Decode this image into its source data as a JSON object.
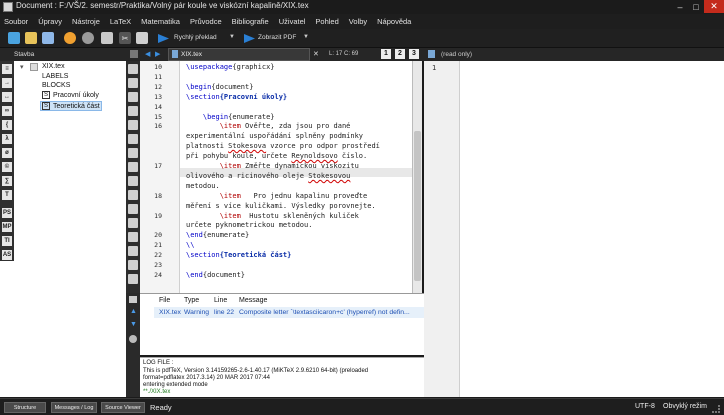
{
  "window": {
    "title": "Document : F:/VŠ/2. semestr/Praktika/Volný pár koule ve viskózní kapalině/XIX.tex"
  },
  "menu": [
    "Soubor",
    "Úpravy",
    "Nástroje",
    "LaTeX",
    "Matematika",
    "Průvodce",
    "Bibliografie",
    "Uživatel",
    "Pohled",
    "Volby",
    "Nápověda"
  ],
  "toolbar": {
    "quick_build": "Rychlý překlad",
    "view_pdf": "Zobrazit PDF"
  },
  "tabbar": {
    "structure_label": "Stavba",
    "file_tab": "XIX.tex",
    "cursor": "L: 17 C: 69",
    "readonly": "(read only)",
    "view_nums": [
      "1",
      "2",
      "3"
    ]
  },
  "structure": {
    "root": "XIX.tex",
    "labels": "LABELS",
    "blocks": "BLOCKS",
    "sections": [
      "Pracovní úkoly",
      "Teoretická část"
    ]
  },
  "editor": {
    "lines": [
      {
        "n": "10",
        "segments": [
          {
            "t": "\\usepackage",
            "c": "kw"
          },
          {
            "t": "{graphicx}",
            "c": ""
          }
        ]
      },
      {
        "n": "11",
        "segments": []
      },
      {
        "n": "12",
        "segments": [
          {
            "t": "\\begin",
            "c": "kw"
          },
          {
            "t": "{document}",
            "c": ""
          }
        ]
      },
      {
        "n": "13",
        "segments": [
          {
            "t": "\\section",
            "c": "kw"
          },
          {
            "t": "{Pracovní úkoly}",
            "c": "sec"
          }
        ]
      },
      {
        "n": "14",
        "segments": []
      },
      {
        "n": "15",
        "segments": [
          {
            "t": "    \\begin",
            "c": "kw"
          },
          {
            "t": "{enumerate}",
            "c": ""
          }
        ]
      },
      {
        "n": "16",
        "segments": [
          {
            "t": "        \\item",
            "c": "red"
          },
          {
            "t": " Ověřte, zda jsou pro dané",
            "c": ""
          }
        ]
      },
      {
        "n": "",
        "segments": [
          {
            "t": "experimentální uspořádání splněny podmínky",
            "c": ""
          }
        ]
      },
      {
        "n": "",
        "segments": [
          {
            "t": "platnosti ",
            "c": ""
          },
          {
            "t": "Stokesova",
            "c": "err"
          },
          {
            "t": " vzorce pro odpor prostředí",
            "c": ""
          }
        ]
      },
      {
        "n": "",
        "segments": [
          {
            "t": "při pohybu koule, určete ",
            "c": ""
          },
          {
            "t": "Reynoldsovo",
            "c": "err"
          },
          {
            "t": " číslo.",
            "c": ""
          }
        ]
      },
      {
        "n": "17",
        "segments": [
          {
            "t": "        \\item",
            "c": "red"
          },
          {
            "t": " Změřte dynamickou viskozitu",
            "c": ""
          }
        ]
      },
      {
        "n": "",
        "segments": [
          {
            "t": "olivového a ricinového oleje ",
            "c": ""
          },
          {
            "t": "Stokesovou",
            "c": "err"
          }
        ]
      },
      {
        "n": "",
        "segments": [
          {
            "t": "metodou.",
            "c": ""
          }
        ]
      },
      {
        "n": "18",
        "segments": [
          {
            "t": "        \\item",
            "c": "red"
          },
          {
            "t": "   Pro jednu kapalinu proveďte",
            "c": ""
          }
        ]
      },
      {
        "n": "",
        "segments": [
          {
            "t": "měření s více kuličkami. Výsledky porovnejte.",
            "c": ""
          }
        ]
      },
      {
        "n": "19",
        "segments": [
          {
            "t": "        \\item",
            "c": "red"
          },
          {
            "t": "  Hustotu skleněných kuliček",
            "c": ""
          }
        ]
      },
      {
        "n": "",
        "segments": [
          {
            "t": "určete pyknometrickou metodou.",
            "c": ""
          }
        ]
      },
      {
        "n": "20",
        "segments": [
          {
            "t": "\\end",
            "c": "kw"
          },
          {
            "t": "{enumerate}",
            "c": ""
          }
        ]
      },
      {
        "n": "21",
        "segments": [
          {
            "t": "\\\\",
            "c": "kw"
          }
        ]
      },
      {
        "n": "22",
        "segments": [
          {
            "t": "\\section",
            "c": "kw"
          },
          {
            "t": "{Teoretická část}",
            "c": "sec"
          }
        ]
      },
      {
        "n": "23",
        "segments": []
      },
      {
        "n": "24",
        "segments": [
          {
            "t": "\\end",
            "c": "kw"
          },
          {
            "t": "{document}",
            "c": ""
          }
        ]
      }
    ]
  },
  "right_editor": {
    "line_number": "1"
  },
  "messages": {
    "headers": [
      "File",
      "Type",
      "Line",
      "Message"
    ],
    "rows": [
      {
        "file": "XIX.tex",
        "type": "Warning",
        "line": "line 22",
        "message": "Composite letter `\\textasciicaron+c' (hyperref) not defin..."
      }
    ]
  },
  "log": {
    "title": "LOG FILE :",
    "lines": [
      "This is pdfTeX, Version 3.14159265-2.6-1.40.17 (MiKTeX 2.9.6210 64-bit) (preloaded",
      "format=pdflatex 2017.3.14) 20 MAR 2017 07:44",
      "entering extended mode",
      "**./XIX.tex"
    ]
  },
  "status": {
    "buttons": [
      "Structure",
      "Messages / Log",
      "Source Viewer"
    ],
    "ready": "Ready",
    "encoding": "UTF-8",
    "mode": "Obvyklý režim"
  }
}
